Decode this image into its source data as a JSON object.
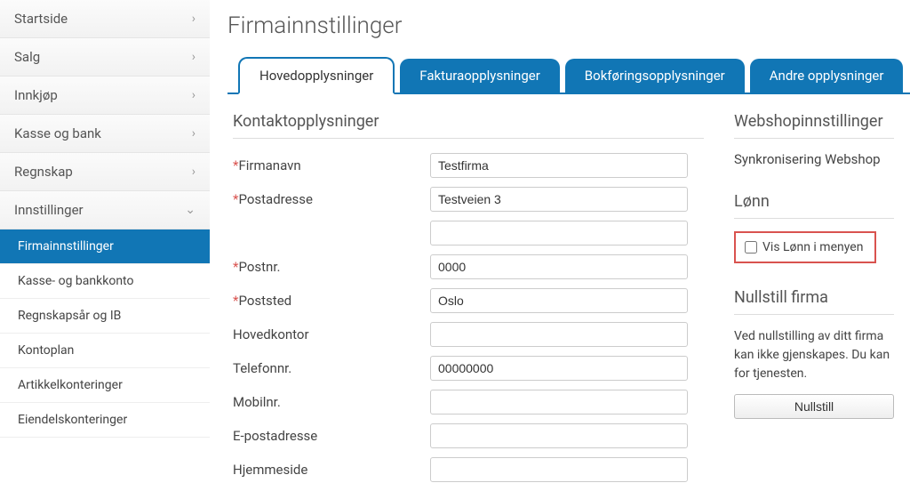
{
  "sidebar": {
    "items": [
      {
        "label": "Startside",
        "expanded": false
      },
      {
        "label": "Salg",
        "expanded": false
      },
      {
        "label": "Innkjøp",
        "expanded": false
      },
      {
        "label": "Kasse og bank",
        "expanded": false
      },
      {
        "label": "Regnskap",
        "expanded": false
      },
      {
        "label": "Innstillinger",
        "expanded": true
      }
    ],
    "subitems": [
      {
        "label": "Firmainnstillinger",
        "active": true
      },
      {
        "label": "Kasse- og bankkonto",
        "active": false
      },
      {
        "label": "Regnskapsår og IB",
        "active": false
      },
      {
        "label": "Kontoplan",
        "active": false
      },
      {
        "label": "Artikkelkonteringer",
        "active": false
      },
      {
        "label": "Eiendelskonteringer",
        "active": false
      }
    ]
  },
  "page_title": "Firmainnstillinger",
  "tabs": [
    {
      "label": "Hovedopplysninger",
      "active": true
    },
    {
      "label": "Fakturaopplysninger",
      "active": false
    },
    {
      "label": "Bokføringsopplysninger",
      "active": false
    },
    {
      "label": "Andre opplysninger",
      "active": false
    }
  ],
  "contact": {
    "section_title": "Kontaktopplysninger",
    "firmanavn_label": "Firmanavn",
    "firmanavn_value": "Testfirma",
    "postadresse_label": "Postadresse",
    "postadresse_value": "Testveien 3",
    "postadresse2_value": "",
    "postnr_label": "Postnr.",
    "postnr_value": "0000",
    "poststed_label": "Poststed",
    "poststed_value": "Oslo",
    "hovedkontor_label": "Hovedkontor",
    "hovedkontor_value": "",
    "telefon_label": "Telefonnr.",
    "telefon_value": "00000000",
    "mobil_label": "Mobilnr.",
    "mobil_value": "",
    "epost_label": "E-postadresse",
    "epost_value": "",
    "hjemmeside_label": "Hjemmeside",
    "hjemmeside_value": ""
  },
  "webshop": {
    "title": "Webshopinnstillinger",
    "sync_label": "Synkronisering Webshop"
  },
  "lonn": {
    "title": "Lønn",
    "checkbox_label": "Vis Lønn i menyen"
  },
  "reset": {
    "title": "Nullstill firma",
    "desc": "Ved nullstilling av ditt firma kan ikke gjenskapes. Du kan for tjenesten.",
    "button": "Nullstill"
  }
}
